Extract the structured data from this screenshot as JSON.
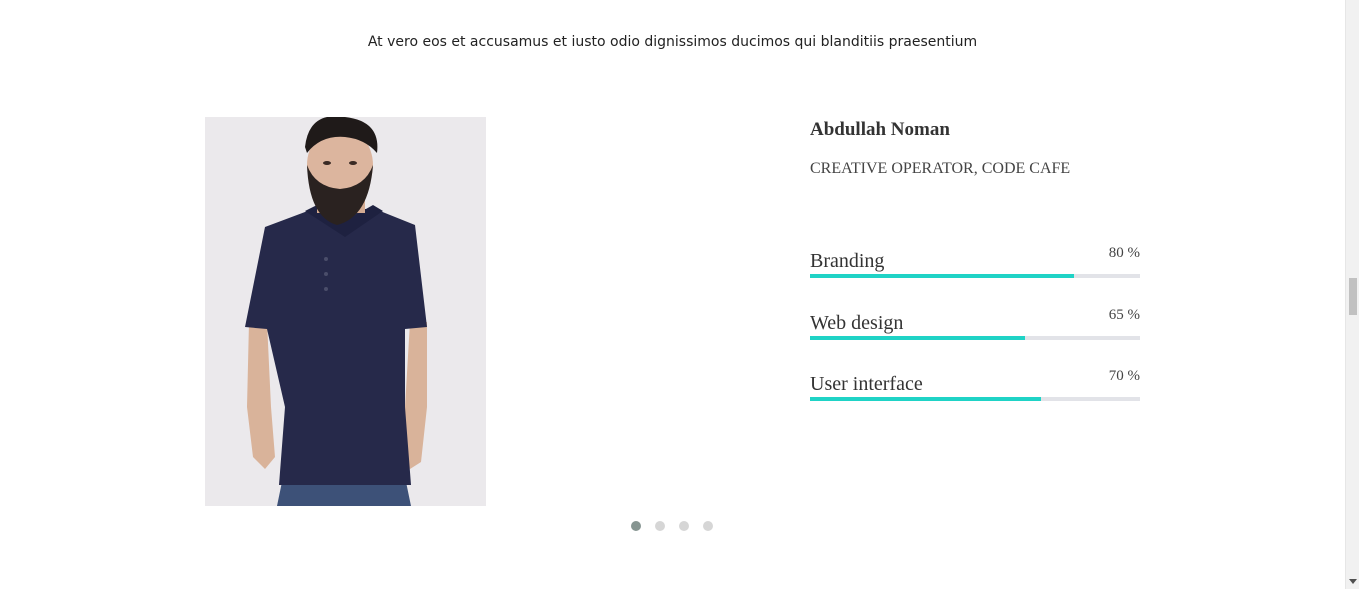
{
  "intro": {
    "text": "At vero eos et accusamus et iusto odio dignissimos ducimos qui blanditiis praesentium"
  },
  "profile": {
    "name": "Abdullah Noman",
    "role": "CREATIVE OPERATOR, CODE CAFE",
    "photo_icon": "person-photo"
  },
  "skills": [
    {
      "label": "Branding",
      "value_text": "80 %",
      "percent": 80
    },
    {
      "label": "Web design",
      "value_text": "65 %",
      "percent": 65
    },
    {
      "label": "User interface",
      "value_text": "70 %",
      "percent": 70
    }
  ],
  "carousel": {
    "dot_count": 4,
    "active_index": 0
  },
  "colors": {
    "accent": "#1fd3c6",
    "track": "#e2e3e8",
    "dot_active": "#869591",
    "dot_inactive": "#d6d6d6"
  }
}
